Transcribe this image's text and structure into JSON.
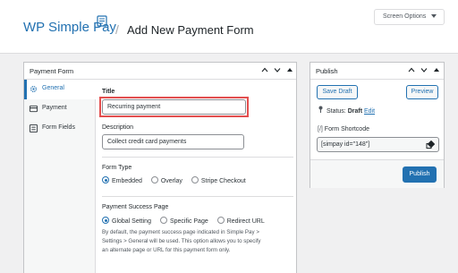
{
  "header": {
    "brand": "WP Simple Pay",
    "separator": "/",
    "page_title": "Add New Payment Form",
    "screen_options": "Screen Options"
  },
  "payment_form": {
    "title": "Payment Form",
    "tabs": [
      {
        "label": "General",
        "icon": "gear-icon",
        "active": true
      },
      {
        "label": "Payment",
        "icon": "card-icon",
        "active": false
      },
      {
        "label": "Form Fields",
        "icon": "list-icon",
        "active": false
      }
    ],
    "title_field": {
      "label": "Title",
      "value": "Recurring payment"
    },
    "description_field": {
      "label": "Description",
      "value": "Collect credit card payments"
    },
    "form_type": {
      "label": "Form Type",
      "options": [
        "Embedded",
        "Overlay",
        "Stripe Checkout"
      ],
      "selected": "Embedded"
    },
    "success_page": {
      "label": "Payment Success Page",
      "options": [
        "Global Setting",
        "Specific Page",
        "Redirect URL"
      ],
      "selected": "Global Setting",
      "help_line1": "By default, the payment success page indicated in Simple Pay >",
      "help_line2": "Settings > General will be used. This option allows you to specify",
      "help_line3": "an alternate page or URL for this payment form only."
    }
  },
  "publish": {
    "title": "Publish",
    "save_draft": "Save Draft",
    "preview": "Preview",
    "status_label": "Status:",
    "status_value": "Draft",
    "status_edit": "Edit",
    "shortcode_label": "Form Shortcode",
    "shortcode_value": "[simpay id=\"148\"]",
    "publish_button": "Publish"
  },
  "colors": {
    "accent": "#2271b1",
    "highlight": "#e34f4f",
    "background": "#f0f0f1"
  }
}
